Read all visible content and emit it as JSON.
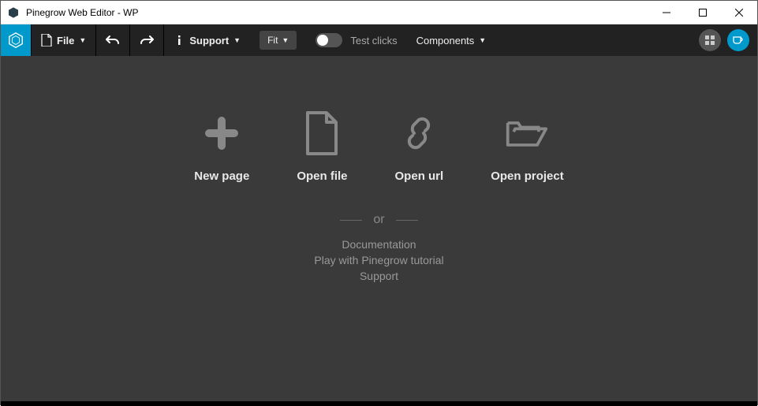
{
  "window": {
    "title": "Pinegrow Web Editor - WP"
  },
  "toolbar": {
    "file_label": "File",
    "support_label": "Support",
    "fit_label": "Fit",
    "test_clicks_label": "Test clicks",
    "components_label": "Components"
  },
  "main": {
    "actions": [
      {
        "label": "New page"
      },
      {
        "label": "Open file"
      },
      {
        "label": "Open url"
      },
      {
        "label": "Open project"
      }
    ],
    "or_label": "or",
    "links": [
      {
        "label": "Documentation"
      },
      {
        "label": "Play with Pinegrow tutorial"
      },
      {
        "label": "Support"
      }
    ]
  }
}
